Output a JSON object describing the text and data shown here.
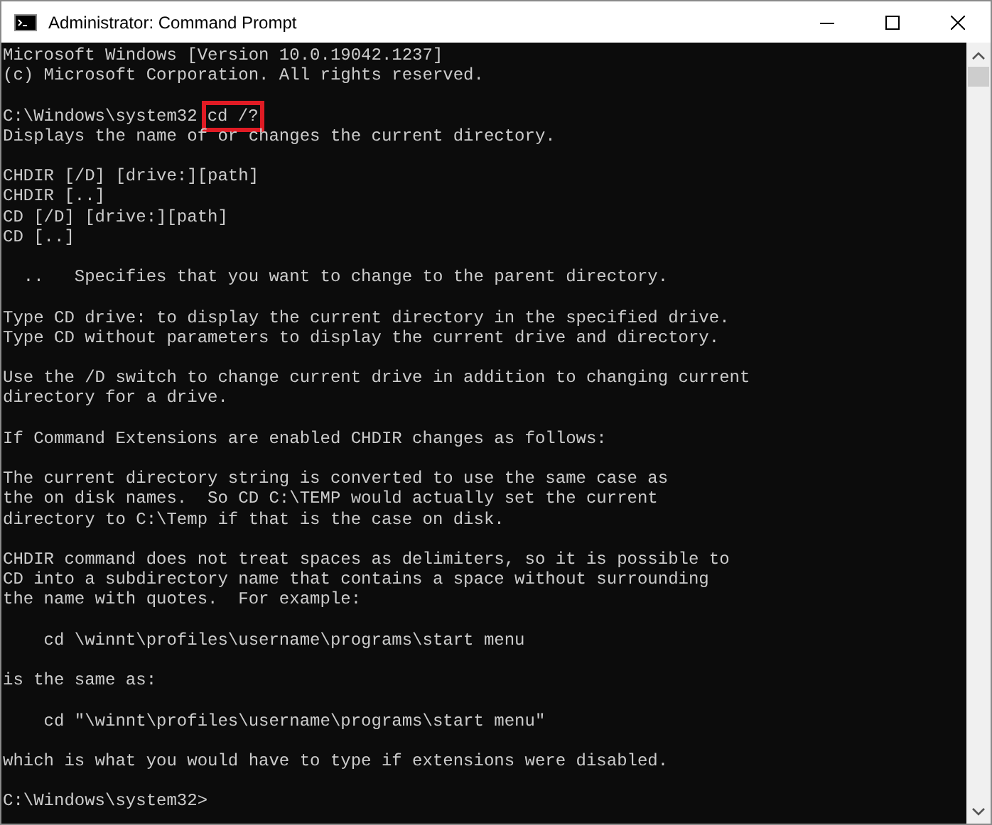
{
  "window": {
    "title": "Administrator: Command Prompt"
  },
  "console": {
    "blocks": [
      {
        "lines": [
          {
            "kind": "text",
            "text": "Microsoft Windows [Version 10.0.19042.1237]"
          },
          {
            "kind": "text",
            "text": "(c) Microsoft Corporation. All rights reserved."
          }
        ]
      },
      {
        "lines": [
          {
            "kind": "prompt",
            "prompt": "C:\\Windows\\system32",
            "command": "cd /?",
            "highlighted": true
          },
          {
            "kind": "text",
            "text": "Displays the name of or changes the current directory."
          }
        ]
      },
      {
        "lines": [
          {
            "kind": "text",
            "text": "CHDIR [/D] [drive:][path]"
          },
          {
            "kind": "text",
            "text": "CHDIR [..]"
          },
          {
            "kind": "text",
            "text": "CD [/D] [drive:][path]"
          },
          {
            "kind": "text",
            "text": "CD [..]"
          }
        ]
      },
      {
        "lines": [
          {
            "kind": "text",
            "text": "  ..   Specifies that you want to change to the parent directory."
          }
        ]
      },
      {
        "lines": [
          {
            "kind": "text",
            "text": "Type CD drive: to display the current directory in the specified drive."
          },
          {
            "kind": "text",
            "text": "Type CD without parameters to display the current drive and directory."
          }
        ]
      },
      {
        "lines": [
          {
            "kind": "text",
            "text": "Use the /D switch to change current drive in addition to changing current"
          },
          {
            "kind": "text",
            "text": "directory for a drive."
          }
        ]
      },
      {
        "lines": [
          {
            "kind": "text",
            "text": "If Command Extensions are enabled CHDIR changes as follows:"
          }
        ]
      },
      {
        "lines": [
          {
            "kind": "text",
            "text": "The current directory string is converted to use the same case as"
          },
          {
            "kind": "text",
            "text": "the on disk names.  So CD C:\\TEMP would actually set the current"
          },
          {
            "kind": "text",
            "text": "directory to C:\\Temp if that is the case on disk."
          }
        ]
      },
      {
        "lines": [
          {
            "kind": "text",
            "text": "CHDIR command does not treat spaces as delimiters, so it is possible to"
          },
          {
            "kind": "text",
            "text": "CD into a subdirectory name that contains a space without surrounding"
          },
          {
            "kind": "text",
            "text": "the name with quotes.  For example:"
          }
        ]
      },
      {
        "lines": [
          {
            "kind": "text",
            "text": "    cd \\winnt\\profiles\\username\\programs\\start menu"
          }
        ]
      },
      {
        "lines": [
          {
            "kind": "text",
            "text": "is the same as:"
          }
        ]
      },
      {
        "lines": [
          {
            "kind": "text",
            "text": "    cd \"\\winnt\\profiles\\username\\programs\\start menu\""
          }
        ]
      },
      {
        "lines": [
          {
            "kind": "text",
            "text": "which is what you would have to type if extensions were disabled."
          }
        ]
      },
      {
        "lines": [
          {
            "kind": "text",
            "text": "C:\\Windows\\system32>"
          }
        ]
      }
    ]
  }
}
